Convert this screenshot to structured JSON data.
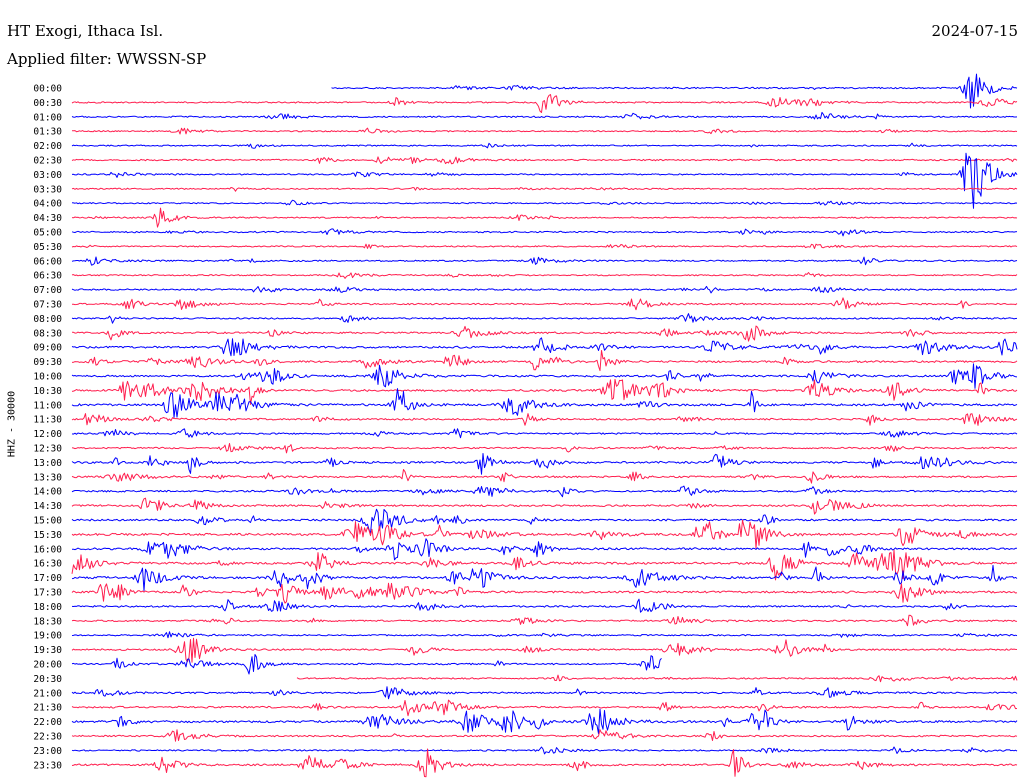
{
  "header": {
    "station": "HT Exogi, Ithaca Isl.",
    "filter": "Applied filter: WWSSN-SP",
    "date": "2024-07-15"
  },
  "channel_label": "HHZ - 30000",
  "colors": {
    "odd": "#0000ff",
    "even": "#ff1f4f",
    "background": "#ffffff",
    "text": "#000000"
  },
  "chart_data": {
    "type": "line",
    "title": "HT Exogi, Ithaca Isl.",
    "ylabel": "HHZ - 30000",
    "grid": false,
    "legend": "none",
    "rows": [
      "00:00",
      "00:30",
      "01:00",
      "01:30",
      "02:00",
      "02:30",
      "03:00",
      "03:30",
      "04:00",
      "04:30",
      "05:00",
      "05:30",
      "06:00",
      "06:30",
      "07:00",
      "07:30",
      "08:00",
      "08:30",
      "09:00",
      "09:30",
      "10:00",
      "10:30",
      "11:00",
      "11:30",
      "12:00",
      "12:30",
      "13:00",
      "13:30",
      "14:00",
      "14:30",
      "15:00",
      "15:30",
      "16:00",
      "16:30",
      "17:00",
      "17:30",
      "18:00",
      "18:30",
      "19:00",
      "19:30",
      "20:00",
      "20:30",
      "21:00",
      "21:30",
      "22:00",
      "22:30",
      "23:00",
      "23:30"
    ],
    "row_activity": [
      0.3,
      0.3,
      0.3,
      0.2,
      0.2,
      0.3,
      0.2,
      0.2,
      0.2,
      0.2,
      0.3,
      0.2,
      0.3,
      0.2,
      0.4,
      0.4,
      0.3,
      0.6,
      0.7,
      0.7,
      0.7,
      0.8,
      0.9,
      0.6,
      0.4,
      0.4,
      0.8,
      0.6,
      0.5,
      0.6,
      0.7,
      0.9,
      0.8,
      0.9,
      0.9,
      0.8,
      0.5,
      0.4,
      0.3,
      0.5,
      0.4,
      0.3,
      0.5,
      0.6,
      0.9,
      0.4,
      0.3,
      0.6
    ],
    "events": [
      {
        "row": 0,
        "minute": 28.5,
        "amplitude": 5.0
      },
      {
        "row": 1,
        "minute": 15.0,
        "amplitude": 2.5
      },
      {
        "row": 6,
        "minute": 28.5,
        "amplitude": 8.0
      },
      {
        "row": 9,
        "minute": 2.8,
        "amplitude": 2.0
      },
      {
        "row": 19,
        "minute": 12.0,
        "amplitude": 2.2
      },
      {
        "row": 22,
        "minute": 10.3,
        "amplitude": 2.8
      },
      {
        "row": 39,
        "minute": 3.8,
        "amplitude": 2.4
      },
      {
        "row": 40,
        "minute": 5.7,
        "amplitude": 2.2
      },
      {
        "row": 47,
        "minute": 21.0,
        "amplitude": 3.0
      }
    ],
    "gaps": [
      {
        "row": 0,
        "from_minute": 0,
        "to_minute": 8.2
      },
      {
        "row": 41,
        "from_minute": 0,
        "to_minute": 7.1
      },
      {
        "row": 40,
        "from_minute": 18.7,
        "to_minute": 30
      }
    ]
  }
}
